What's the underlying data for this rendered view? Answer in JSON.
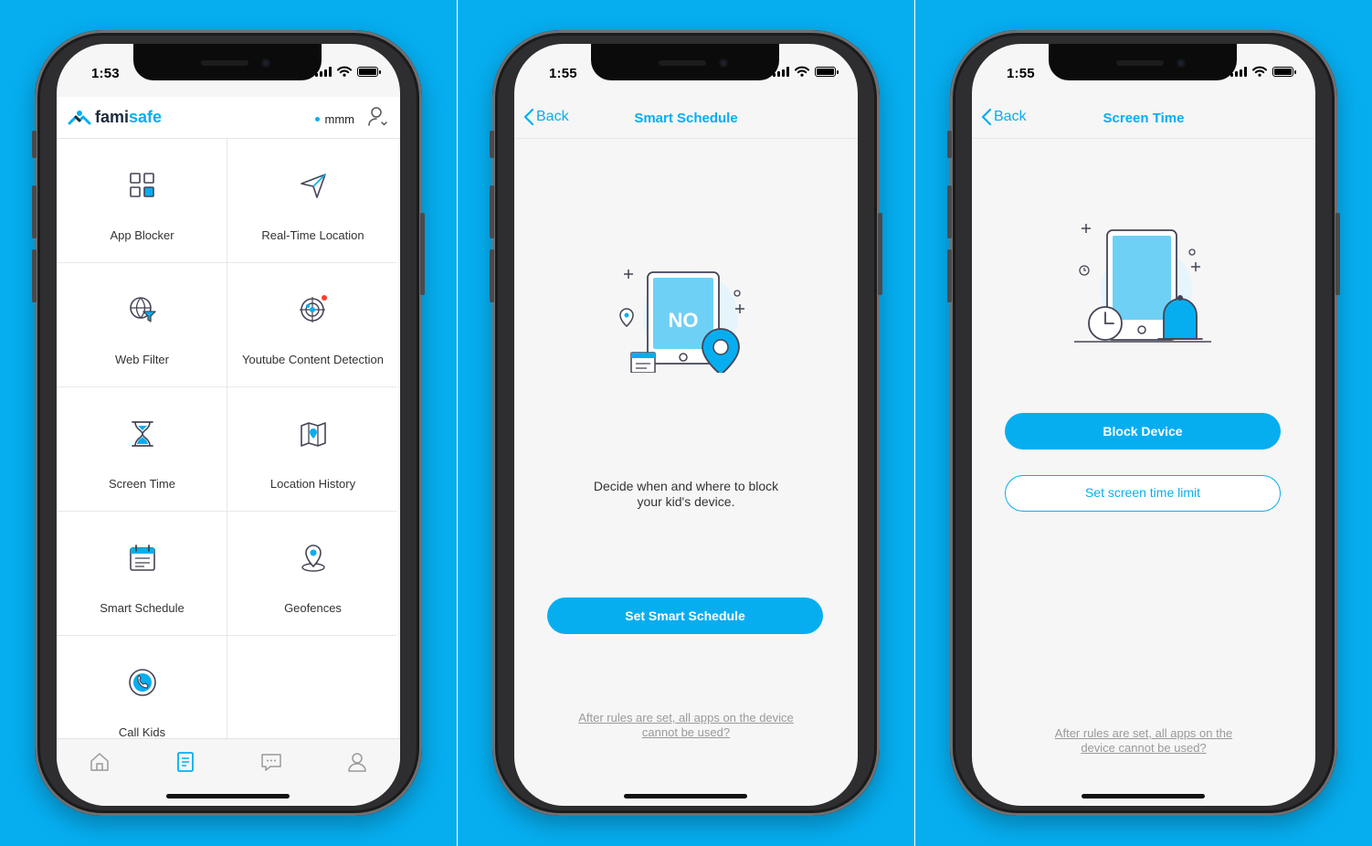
{
  "colors": {
    "background": "#06aef0",
    "accent": "#06aef0",
    "screen": "#f6f6f6"
  },
  "screens": [
    {
      "status": {
        "time": "1:53"
      },
      "header": {
        "logo_part1": "fami",
        "logo_part2": "safe",
        "child_name": "mmm",
        "profile_icon": "user-settings-icon"
      },
      "tiles": [
        {
          "label": "App Blocker",
          "icon": "app-blocker-icon"
        },
        {
          "label": "Real-Time Location",
          "icon": "paper-plane-icon"
        },
        {
          "label": "Web Filter",
          "icon": "web-filter-icon"
        },
        {
          "label": "Youtube Content Detection",
          "icon": "radar-icon"
        },
        {
          "label": "Screen Time",
          "icon": "hourglass-icon"
        },
        {
          "label": "Location History",
          "icon": "map-icon"
        },
        {
          "label": "Smart Schedule",
          "icon": "calendar-icon"
        },
        {
          "label": "Geofences",
          "icon": "location-pin-icon"
        },
        {
          "label": "Call Kids",
          "icon": "phone-call-icon"
        }
      ],
      "tabbar": [
        "home-icon",
        "features-icon",
        "messages-icon",
        "account-icon"
      ]
    },
    {
      "status": {
        "time": "1:55"
      },
      "nav": {
        "back": "Back",
        "title": "Smart Schedule"
      },
      "illustration": {
        "badge": "NO"
      },
      "description_line1": "Decide when and where to block",
      "description_line2": "your kid's device.",
      "button": "Set Smart Schedule",
      "help_line1": "After  rules are set, all apps on the device",
      "help_line2": "cannot be used?"
    },
    {
      "status": {
        "time": "1:55"
      },
      "nav": {
        "back": "Back",
        "title": "Screen Time"
      },
      "primary_button": "Block Device",
      "secondary_button": "Set screen time limit",
      "help_line1": "After  rules are set, all apps on the",
      "help_line2": "device cannot be used?"
    }
  ]
}
